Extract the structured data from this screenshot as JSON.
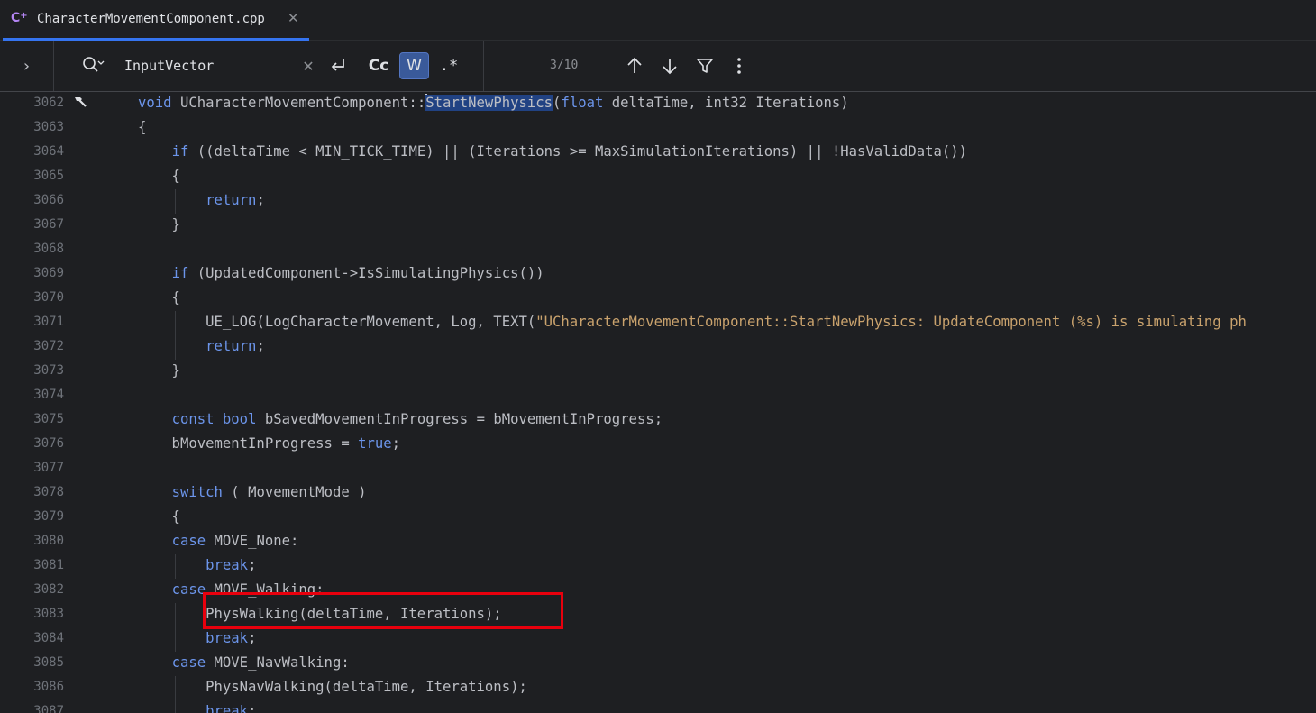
{
  "tab": {
    "file_name": "CharacterMovementComponent.cpp",
    "icon": "cpp-file-icon"
  },
  "search": {
    "query": "InputVector",
    "cc_label": "Cc",
    "w_label": "W",
    "regex_label": ".*",
    "match_count": "3/10"
  },
  "colors": {
    "keyword": "#6c95eb",
    "string": "#c9a26d",
    "text": "#bcbec4",
    "line_number": "#6f737a",
    "accent": "#3574f0",
    "annotation": "#e8000d"
  },
  "editor": {
    "lines": [
      {
        "num": "3062",
        "parts": [
          {
            "t": "void",
            "c": "kw"
          },
          {
            "t": " UCharacterMovementComponent::"
          },
          {
            "t": "CARET",
            "c": "caret"
          },
          {
            "t": "StartNewPhysics",
            "c": "sel"
          },
          {
            "t": "("
          },
          {
            "t": "float",
            "c": "kw"
          },
          {
            "t": " deltaTime, int32 Iterations)"
          }
        ]
      },
      {
        "num": "3063",
        "parts": [
          {
            "t": "{"
          }
        ]
      },
      {
        "num": "3064",
        "parts": [
          {
            "t": "    "
          },
          {
            "t": "if",
            "c": "kw"
          },
          {
            "t": " ((deltaTime < MIN_TICK_TIME) || (Iterations >= MaxSimulationIterations) || !HasValidData())"
          }
        ]
      },
      {
        "num": "3065",
        "parts": [
          {
            "t": "    {"
          }
        ]
      },
      {
        "num": "3066",
        "parts": [
          {
            "t": "        "
          },
          {
            "t": "return",
            "c": "kw"
          },
          {
            "t": ";"
          }
        ]
      },
      {
        "num": "3067",
        "parts": [
          {
            "t": "    }"
          }
        ]
      },
      {
        "num": "3068",
        "parts": []
      },
      {
        "num": "3069",
        "parts": [
          {
            "t": "    "
          },
          {
            "t": "if",
            "c": "kw"
          },
          {
            "t": " (UpdatedComponent->IsSimulatingPhysics())"
          }
        ]
      },
      {
        "num": "3070",
        "parts": [
          {
            "t": "    {"
          }
        ]
      },
      {
        "num": "3071",
        "parts": [
          {
            "t": "        UE_LOG(LogCharacterMovement, Log, TEXT("
          },
          {
            "t": "\"UCharacterMovementComponent::StartNewPhysics: UpdateComponent (%s) is simulating ph",
            "c": "str"
          }
        ]
      },
      {
        "num": "3072",
        "parts": [
          {
            "t": "        "
          },
          {
            "t": "return",
            "c": "kw"
          },
          {
            "t": ";"
          }
        ]
      },
      {
        "num": "3073",
        "parts": [
          {
            "t": "    }"
          }
        ]
      },
      {
        "num": "3074",
        "parts": []
      },
      {
        "num": "3075",
        "parts": [
          {
            "t": "    "
          },
          {
            "t": "const",
            "c": "kw"
          },
          {
            "t": " "
          },
          {
            "t": "bool",
            "c": "kw"
          },
          {
            "t": " bSavedMovementInProgress = bMovementInProgress;"
          }
        ]
      },
      {
        "num": "3076",
        "parts": [
          {
            "t": "    bMovementInProgress = "
          },
          {
            "t": "true",
            "c": "kw"
          },
          {
            "t": ";"
          }
        ]
      },
      {
        "num": "3077",
        "parts": []
      },
      {
        "num": "3078",
        "parts": [
          {
            "t": "    "
          },
          {
            "t": "switch",
            "c": "kw"
          },
          {
            "t": " ( MovementMode )"
          }
        ]
      },
      {
        "num": "3079",
        "parts": [
          {
            "t": "    {"
          }
        ]
      },
      {
        "num": "3080",
        "parts": [
          {
            "t": "    "
          },
          {
            "t": "case",
            "c": "kw"
          },
          {
            "t": " MOVE_None:"
          }
        ]
      },
      {
        "num": "3081",
        "parts": [
          {
            "t": "        "
          },
          {
            "t": "break",
            "c": "kw"
          },
          {
            "t": ";"
          }
        ]
      },
      {
        "num": "3082",
        "parts": [
          {
            "t": "    "
          },
          {
            "t": "case",
            "c": "kw"
          },
          {
            "t": " MOVE_Walking:"
          }
        ]
      },
      {
        "num": "3083",
        "parts": [
          {
            "t": "        PhysWalking(deltaTime, Iterations);"
          }
        ]
      },
      {
        "num": "3084",
        "parts": [
          {
            "t": "        "
          },
          {
            "t": "break",
            "c": "kw"
          },
          {
            "t": ";"
          }
        ]
      },
      {
        "num": "3085",
        "parts": [
          {
            "t": "    "
          },
          {
            "t": "case",
            "c": "kw"
          },
          {
            "t": " MOVE_NavWalking:"
          }
        ]
      },
      {
        "num": "3086",
        "parts": [
          {
            "t": "        PhysNavWalking(deltaTime, Iterations);"
          }
        ]
      },
      {
        "num": "3087",
        "parts": [
          {
            "t": "        "
          },
          {
            "t": "break",
            "c": "kw"
          },
          {
            "t": ";"
          }
        ]
      }
    ]
  }
}
